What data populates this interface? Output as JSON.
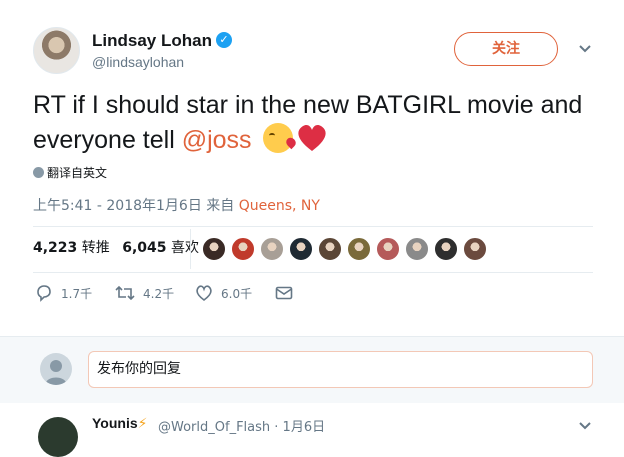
{
  "tweet": {
    "display_name": "Lindsay Lohan",
    "handle": "@lindsaylohan",
    "verified_icon": "verified-badge-icon",
    "follow_label": "关注",
    "text_plain": "RT if I should star in the  new BATGIRL movie and everyone tell ",
    "mention": "@joss",
    "emojis": [
      "face-blowing-kiss-emoji",
      "red-heart-emoji"
    ],
    "translate_label": "翻译自英文",
    "timestamp": "上午5:41 - 2018年1月6日 来自 ",
    "location": "Queens, NY",
    "retweet_count": "4,223",
    "retweet_label": "转推",
    "like_count": "6,045",
    "like_label": "喜欢",
    "likers": [
      {
        "color": "#3a2a25"
      },
      {
        "color": "#c03a2b"
      },
      {
        "color": "#a89f96"
      },
      {
        "color": "#1f2a33"
      },
      {
        "color": "#5b4636"
      },
      {
        "color": "#7a6a3a"
      },
      {
        "color": "#b55a5a"
      },
      {
        "color": "#8a8a8a"
      },
      {
        "color": "#2e2e2e"
      },
      {
        "color": "#6b4a3e"
      }
    ],
    "actions": {
      "reply_count": "1.7千",
      "retweet_count": "4.2千",
      "like_count": "6.0千"
    }
  },
  "reply": {
    "placeholder": "发布你的回复"
  },
  "next_tweet": {
    "display_name": "Younis",
    "emoji": "⚡",
    "handle": "@World_Of_Flash",
    "date": "· 1月6日"
  },
  "colors": {
    "accent": "#e0633b",
    "verified": "#1da1f2",
    "heart": "#dd2e44"
  }
}
